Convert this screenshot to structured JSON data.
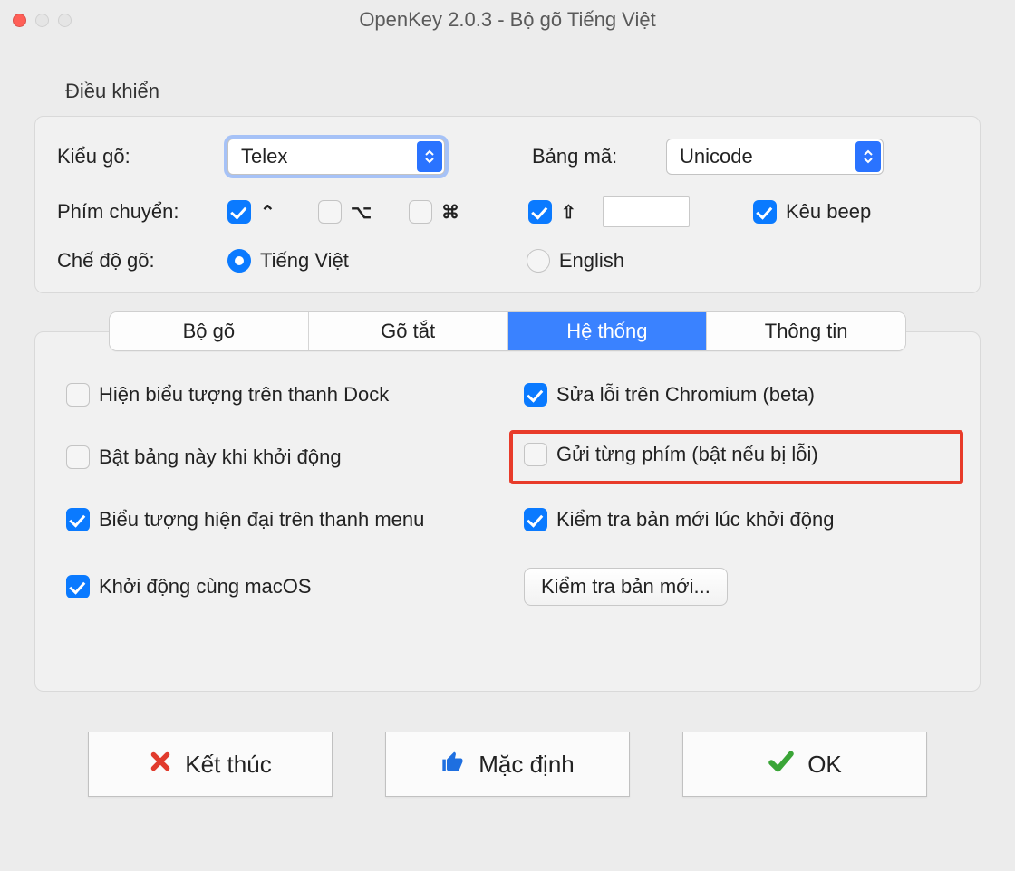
{
  "window": {
    "title": "OpenKey 2.0.3 - Bộ gõ Tiếng Việt"
  },
  "control_group": {
    "legend": "Điều khiển",
    "input_method_label": "Kiểu gõ:",
    "input_method_value": "Telex",
    "encoding_label": "Bảng mã:",
    "encoding_value": "Unicode",
    "switch_key_label": "Phím chuyển:",
    "ctrl_glyph": "⌃",
    "opt_glyph": "⌥",
    "cmd_glyph": "⌘",
    "shift_glyph": "⇧",
    "beep_label": "Kêu beep",
    "mode_label": "Chế độ gõ:",
    "mode_vn": "Tiếng Việt",
    "mode_en": "English"
  },
  "tabs": {
    "items": [
      "Bộ gõ",
      "Gõ tắt",
      "Hệ thống",
      "Thông tin"
    ]
  },
  "system": {
    "show_dock": "Hiện biểu tượng trên thanh Dock",
    "open_on_start": "Bật bảng này khi khởi động",
    "modern_icon": "Biểu tượng hiện đại trên thanh menu",
    "run_at_login": "Khởi động cùng macOS",
    "fix_chromium": "Sửa lỗi trên Chromium (beta)",
    "send_each_key": "Gửi từng phím (bật nếu bị lỗi)",
    "check_update_start": "Kiểm tra bản mới lúc khởi động",
    "check_update_btn": "Kiểm tra bản mới..."
  },
  "footer": {
    "quit": "Kết thúc",
    "default": "Mặc định",
    "ok": "OK"
  }
}
